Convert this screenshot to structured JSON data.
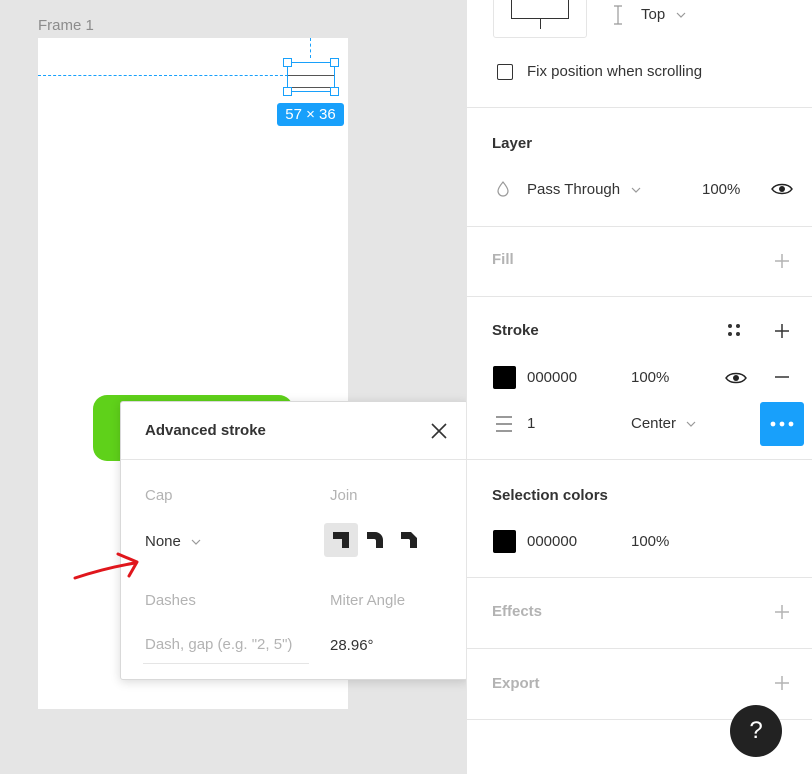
{
  "canvas": {
    "frame_label": "Frame 1",
    "size_badge": "57 × 36"
  },
  "popup": {
    "title": "Advanced stroke",
    "cap_label": "Cap",
    "join_label": "Join",
    "cap_value": "None",
    "dashes_label": "Dashes",
    "miter_label": "Miter Angle",
    "dash_placeholder": "Dash, gap (e.g. \"2, 5\")",
    "miter_value": "28.96°"
  },
  "panel": {
    "constraints": {
      "vertical_value": "Top",
      "fix_position_label": "Fix position when scrolling"
    },
    "layer": {
      "title": "Layer",
      "blend_mode": "Pass Through",
      "opacity": "100%"
    },
    "fill": {
      "title": "Fill"
    },
    "stroke": {
      "title": "Stroke",
      "color_hex": "000000",
      "opacity": "100%",
      "weight": "1",
      "align": "Center"
    },
    "selection_colors": {
      "title": "Selection colors",
      "color_hex": "000000",
      "opacity": "100%"
    },
    "effects": {
      "title": "Effects"
    },
    "export": {
      "title": "Export"
    },
    "help_label": "?"
  },
  "colors": {
    "accent": "#18a0fb",
    "button_green": "#5fd11a",
    "annotation_red": "#e0161c",
    "swatch": "#000000"
  }
}
